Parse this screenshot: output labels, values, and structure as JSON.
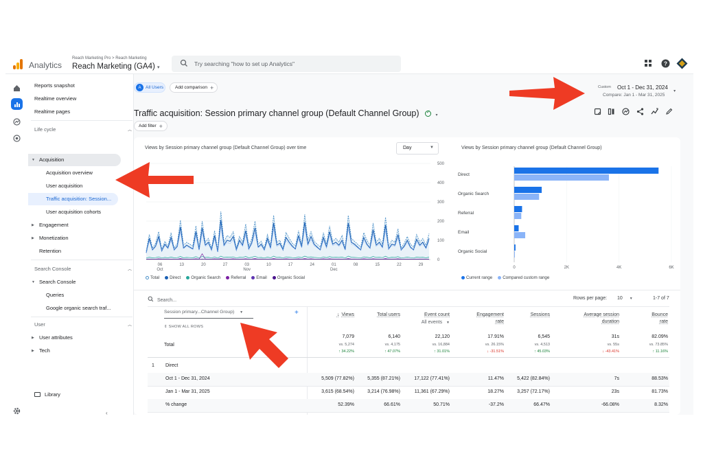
{
  "app": {
    "brand": "Analytics",
    "property_path": "Reach Marketing Pro > Reach Marketing",
    "property_name": "Reach Marketing (GA4)",
    "search_placeholder": "Try searching \"how to set up Analytics\""
  },
  "icons": {
    "home": "home-icon",
    "reports": "reports-icon",
    "explore": "explore-icon",
    "advertising": "advertising-icon",
    "admin": "gear-icon",
    "apps": "apps-icon",
    "help": "help-icon",
    "account": "account-avatar"
  },
  "nav": {
    "top_items": [
      "Reports snapshot",
      "Realtime overview",
      "Realtime pages"
    ],
    "section_lifecycle": "Life cycle",
    "acquisition": "Acquisition",
    "acquisition_items": [
      "Acquisition overview",
      "User acquisition",
      "Traffic acquisition: Session...",
      "User acquisition cohorts"
    ],
    "engagement": "Engagement",
    "monetization": "Monetization",
    "retention": "Retention",
    "section_search_console": "Search Console",
    "search_console": "Search Console",
    "search_console_items": [
      "Queries",
      "Google organic search traf..."
    ],
    "section_user": "User",
    "user_attributes": "User attributes",
    "tech": "Tech",
    "library": "Library"
  },
  "toolbar": {
    "all_users_avatar": "A",
    "all_users": "All Users",
    "add_comparison": "Add comparison",
    "date_label": "Custom",
    "date_range": "Oct 1 - Dec 31, 2024",
    "compare": "Compare: Jan 1 - Mar 31, 2025",
    "add_filter": "Add filter"
  },
  "page": {
    "title": "Traffic acquisition: Session primary channel group (Default Channel Group)"
  },
  "line_chart": {
    "title": "Views by Session primary channel group (Default Channel Group) over time",
    "granularity": "Day",
    "y_ticks": [
      "500",
      "400",
      "300",
      "200",
      "100",
      "0"
    ],
    "x_ticks": [
      {
        "day": "06",
        "month": "Oct"
      },
      {
        "day": "13",
        "month": ""
      },
      {
        "day": "20",
        "month": ""
      },
      {
        "day": "27",
        "month": ""
      },
      {
        "day": "03",
        "month": "Nov"
      },
      {
        "day": "10",
        "month": ""
      },
      {
        "day": "17",
        "month": ""
      },
      {
        "day": "24",
        "month": ""
      },
      {
        "day": "01",
        "month": "Dec"
      },
      {
        "day": "08",
        "month": ""
      },
      {
        "day": "15",
        "month": ""
      },
      {
        "day": "22",
        "month": ""
      },
      {
        "day": "29",
        "month": ""
      }
    ],
    "legend": [
      "Total",
      "Direct",
      "Organic Search",
      "Referral",
      "Email",
      "Organic Social"
    ],
    "colors": {
      "total": "#4a90c8",
      "direct": "#1a5fb4",
      "organic_search": "#26a69a",
      "referral": "#7b1fa2",
      "email": "#5e35b1",
      "organic_social": "#4a148c"
    }
  },
  "bar_chart": {
    "title": "Views by Session primary channel group (Default Channel Group)",
    "x_ticks": [
      "0",
      "2K",
      "4K",
      "6K"
    ],
    "legend": [
      "Current range",
      "Compared custom range"
    ],
    "colors": {
      "current": "#1a73e8",
      "compared": "#8ab4f8"
    }
  },
  "chart_data": [
    {
      "type": "line",
      "title": "Views by Session primary channel group (Default Channel Group) over time",
      "ylim": [
        0,
        500
      ],
      "x_range": [
        "2024-10-01",
        "2024-12-31"
      ],
      "series": [
        {
          "name": "Total",
          "values": [
            45,
            130,
            60,
            85,
            145,
            55,
            95,
            70,
            140,
            60,
            85,
            205,
            75,
            90,
            80,
            70,
            175,
            60,
            200,
            90,
            110,
            60,
            150,
            50,
            250,
            90,
            125,
            115,
            145,
            60,
            120,
            90,
            185,
            70,
            110,
            200,
            80,
            95,
            60,
            130,
            75,
            230,
            90,
            100,
            60,
            140,
            110,
            85,
            70,
            150,
            80,
            235,
            100,
            145,
            95,
            80,
            65,
            140,
            80,
            175,
            95,
            110,
            90,
            125,
            60,
            230,
            110,
            95,
            80,
            65,
            140,
            100,
            75,
            190,
            90,
            110,
            80,
            220,
            70,
            100,
            90,
            160,
            60,
            85,
            120,
            80,
            65,
            130,
            90,
            110,
            75,
            135
          ]
        },
        {
          "name": "Direct",
          "values": [
            35,
            110,
            50,
            70,
            120,
            45,
            80,
            60,
            115,
            50,
            70,
            170,
            60,
            75,
            65,
            55,
            145,
            50,
            165,
            75,
            90,
            50,
            125,
            40,
            205,
            75,
            100,
            95,
            120,
            50,
            100,
            75,
            150,
            55,
            90,
            165,
            65,
            80,
            50,
            110,
            60,
            190,
            75,
            85,
            50,
            115,
            90,
            70,
            55,
            125,
            65,
            195,
            80,
            120,
            80,
            65,
            50,
            115,
            65,
            145,
            80,
            90,
            75,
            100,
            50,
            190,
            90,
            80,
            65,
            50,
            115,
            80,
            60,
            155,
            75,
            90,
            65,
            180,
            55,
            80,
            75,
            130,
            50,
            70,
            100,
            65,
            50,
            105,
            75,
            90,
            60,
            110
          ]
        },
        {
          "name": "Organic Search",
          "values": [
            8,
            12,
            9,
            10,
            14,
            8,
            11,
            9,
            13,
            9,
            10,
            16,
            9,
            11,
            10,
            9,
            15,
            8,
            16,
            11,
            12,
            8,
            14,
            7,
            18,
            11,
            13,
            12,
            14,
            8,
            12,
            11,
            16,
            9,
            12,
            17,
            10,
            11,
            8,
            13,
            9,
            18,
            11,
            12,
            8,
            14,
            12,
            10,
            9,
            14,
            10,
            18,
            12,
            14,
            11,
            10,
            8,
            14,
            10,
            15,
            11,
            12,
            11,
            13,
            8,
            18,
            12,
            11,
            10,
            8,
            14,
            12,
            9,
            16,
            11,
            12,
            10,
            17,
            9,
            12,
            11,
            15,
            8,
            10,
            13,
            10,
            8,
            13,
            11,
            12,
            9,
            13
          ]
        },
        {
          "name": "Referral",
          "values": [
            2,
            3,
            2,
            2,
            4,
            2,
            3,
            2,
            3,
            2,
            2,
            5,
            2,
            3,
            2,
            2,
            4,
            2,
            30,
            3,
            3,
            2,
            4,
            2,
            5,
            3,
            3,
            3,
            4,
            2,
            3,
            3,
            4,
            2,
            3,
            5,
            2,
            3,
            2,
            3,
            2,
            5,
            3,
            3,
            2,
            4,
            3,
            2,
            2,
            4,
            2,
            5,
            3,
            4,
            3,
            2,
            2,
            4,
            2,
            4,
            3,
            3,
            3,
            3,
            2,
            5,
            3,
            3,
            2,
            2,
            4,
            3,
            2,
            4,
            3,
            3,
            2,
            5,
            2,
            3,
            3,
            4,
            2,
            2,
            3,
            2,
            2,
            3,
            3,
            3,
            2,
            3
          ]
        },
        {
          "name": "Email",
          "values": [
            1,
            2,
            1,
            1,
            2,
            1,
            1,
            1,
            2,
            1,
            1,
            3,
            1,
            1,
            1,
            1,
            2,
            1,
            3,
            1,
            2,
            1,
            2,
            1,
            3,
            1,
            2,
            2,
            2,
            1,
            2,
            1,
            2,
            1,
            2,
            3,
            1,
            1,
            1,
            2,
            1,
            3,
            1,
            2,
            1,
            2,
            2,
            1,
            1,
            2,
            1,
            3,
            2,
            2,
            1,
            1,
            1,
            2,
            1,
            2,
            1,
            2,
            1,
            2,
            1,
            3,
            2,
            1,
            1,
            1,
            2,
            2,
            1,
            2,
            1,
            2,
            1,
            3,
            1,
            2,
            1,
            2,
            1,
            1,
            2,
            1,
            1,
            2,
            1,
            2,
            1,
            2
          ]
        },
        {
          "name": "Organic Social",
          "values": [
            1,
            1,
            1,
            1,
            1,
            1,
            1,
            1,
            1,
            1,
            1,
            2,
            1,
            1,
            1,
            1,
            1,
            1,
            2,
            1,
            1,
            1,
            1,
            1,
            2,
            1,
            1,
            1,
            1,
            1,
            1,
            1,
            1,
            1,
            1,
            2,
            1,
            1,
            1,
            1,
            1,
            2,
            1,
            1,
            1,
            1,
            1,
            1,
            1,
            1,
            1,
            2,
            1,
            1,
            1,
            1,
            1,
            1,
            1,
            1,
            1,
            1,
            1,
            1,
            1,
            2,
            1,
            1,
            1,
            1,
            1,
            1,
            1,
            1,
            1,
            1,
            1,
            2,
            1,
            1,
            1,
            1,
            1,
            1,
            1,
            1,
            1,
            1,
            1,
            1,
            1,
            1
          ]
        }
      ]
    },
    {
      "type": "bar",
      "title": "Views by Session primary channel group (Default Channel Group)",
      "categories": [
        "Direct",
        "Organic Search",
        "Referral",
        "Email",
        "Organic Social"
      ],
      "xlim": [
        0,
        6000
      ],
      "series": [
        {
          "name": "Current range",
          "values": [
            5509,
            1050,
            300,
            170,
            50
          ]
        },
        {
          "name": "Compared custom range",
          "values": [
            3615,
            950,
            270,
            420,
            20
          ]
        }
      ]
    },
    {
      "type": "table",
      "dimension_header": "Session primary...Channel Group)",
      "show_all_rows": "SHOW ALL ROWS",
      "columns": [
        {
          "label": "Views",
          "sort": "↓"
        },
        {
          "label": "Total users",
          "sort": ""
        },
        {
          "label": "Event count",
          "sort": "",
          "sub": "All events"
        },
        {
          "label": "Engagement rate",
          "sort": ""
        },
        {
          "label": "Sessions",
          "sort": ""
        },
        {
          "label": "Average session duration",
          "sort": ""
        },
        {
          "label": "Bounce rate",
          "sort": ""
        }
      ],
      "total": {
        "label": "Total",
        "values": [
          "7,079",
          "6,140",
          "22,120",
          "17.91%",
          "6,545",
          "31s",
          "82.09%"
        ],
        "compare": [
          "vs. 5,274",
          "vs. 4,175",
          "vs. 16,884",
          "vs. 26.15%",
          "vs. 4,513",
          "vs. 55s",
          "vs. 73.85%"
        ],
        "change": [
          "↑ 34.22%",
          "↑ 47.07%",
          "↑ 31.01%",
          "↓ -31.51%",
          "↑ 45.03%",
          "↓ -43.41%",
          "↑ 11.16%"
        ],
        "change_dir": [
          "up",
          "up",
          "up",
          "down",
          "up",
          "down",
          "up"
        ]
      },
      "group": {
        "index": "1",
        "label": "Direct"
      },
      "rows": [
        {
          "label": "Oct 1 - Dec 31, 2024",
          "values": [
            "5,509 (77.82%)",
            "5,355 (87.21%)",
            "17,122 (77.41%)",
            "11.47%",
            "5,422 (82.84%)",
            "7s",
            "88.53%"
          ]
        },
        {
          "label": "Jan 1 - Mar 31, 2025",
          "values": [
            "3,615 (68.54%)",
            "3,214 (76.98%)",
            "11,361 (67.29%)",
            "18.27%",
            "3,257 (72.17%)",
            "23s",
            "81.73%"
          ]
        },
        {
          "label": "% change",
          "values": [
            "52.39%",
            "66.61%",
            "50.71%",
            "-37.2%",
            "66.47%",
            "-66.08%",
            "8.32%"
          ]
        }
      ]
    }
  ],
  "table_ui": {
    "search_placeholder": "Search...",
    "rows_per_page_label": "Rows per page:",
    "rows_per_page": "10",
    "range": "1-7 of 7"
  },
  "annotation_color": "#ee3b24"
}
